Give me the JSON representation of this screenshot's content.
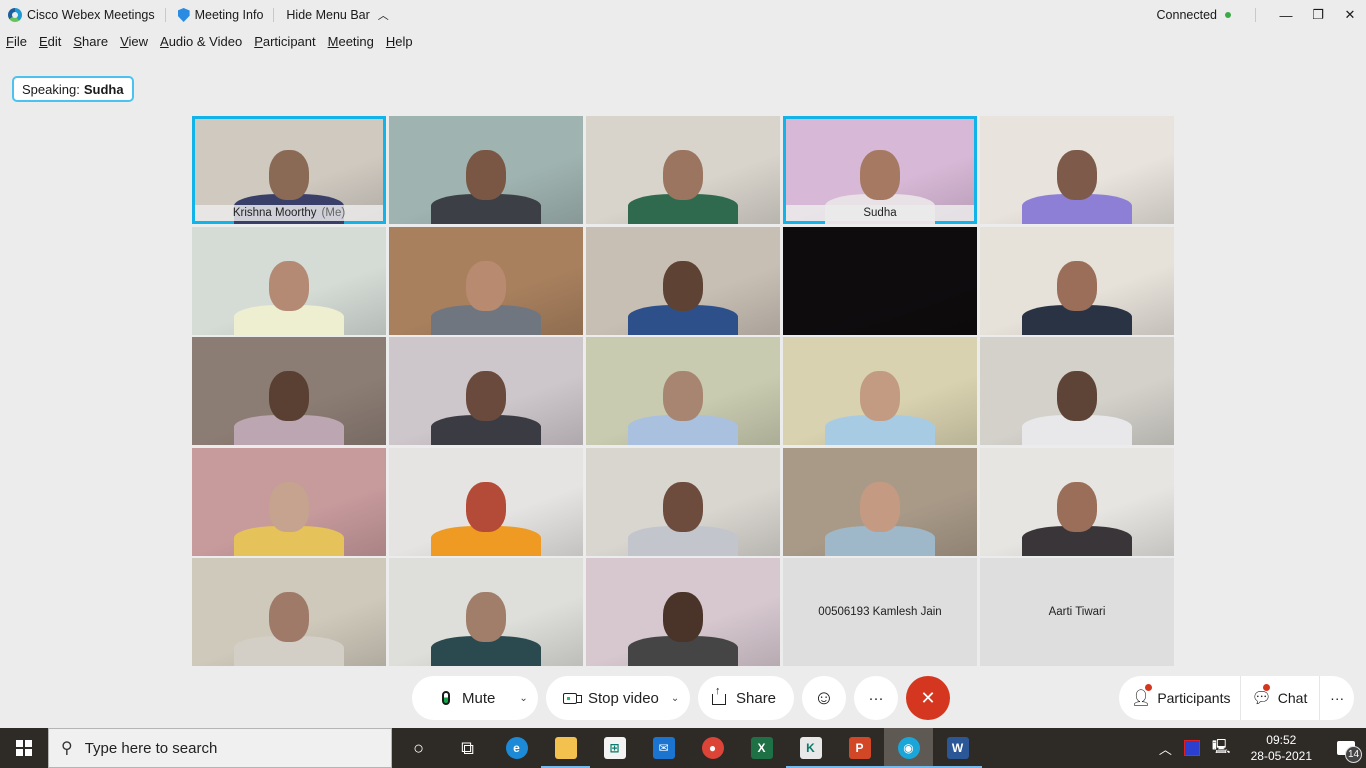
{
  "titlebar": {
    "app_name": "Cisco Webex Meetings",
    "meeting_info": "Meeting Info",
    "hide_menu_bar": "Hide Menu Bar",
    "status": "Connected",
    "status_color": "#3bab48",
    "minimize": "—",
    "restore": "❐",
    "close": "✕"
  },
  "menu": {
    "items": [
      {
        "mnemonic": "F",
        "rest": "ile"
      },
      {
        "mnemonic": "E",
        "rest": "dit"
      },
      {
        "mnemonic": "S",
        "rest": "hare"
      },
      {
        "mnemonic": "V",
        "rest": "iew"
      },
      {
        "mnemonic": "A",
        "rest": "udio & Video"
      },
      {
        "mnemonic": "P",
        "rest": "articipant"
      },
      {
        "mnemonic": "M",
        "rest": "eeting"
      },
      {
        "mnemonic": "H",
        "rest": "elp"
      }
    ]
  },
  "speaking": {
    "prefix": "Speaking:",
    "name": "Sudha"
  },
  "participants": [
    {
      "name": "Krishna Moorthy",
      "suffix": "(Me)",
      "active": true,
      "video": true,
      "bg": "#cfc9c0",
      "skin": "#8a6a55",
      "shirt": "#3a3f6a"
    },
    {
      "name": "",
      "video": true,
      "bg": "#9fb3b0",
      "skin": "#7a5744",
      "shirt": "#3c3f46"
    },
    {
      "name": "",
      "video": true,
      "bg": "#d8d4cc",
      "skin": "#9b7560",
      "shirt": "#2f6a4f"
    },
    {
      "name": "Sudha",
      "active": true,
      "video": true,
      "bg": "#d7b8d6",
      "skin": "#a67a62",
      "shirt": "#e8e2e6"
    },
    {
      "name": "",
      "video": true,
      "bg": "#e8e3dc",
      "skin": "#7d5a4a",
      "shirt": "#8e7fd6"
    },
    {
      "name": "",
      "video": true,
      "bg": "#d5dcd6",
      "skin": "#b48a75",
      "shirt": "#eeeed0"
    },
    {
      "name": "",
      "video": true,
      "bg": "#a8805e",
      "skin": "#b88a70",
      "shirt": "#707680"
    },
    {
      "name": "",
      "video": true,
      "bg": "#c8bfb4",
      "skin": "#5e4334",
      "shirt": "#2d4f8a"
    },
    {
      "name": "",
      "video": true,
      "bg": "#0f0c0e",
      "skin": "#0f0c0e",
      "shirt": "#0f0c0e",
      "blank": true
    },
    {
      "name": "",
      "video": true,
      "bg": "#e6e1d9",
      "skin": "#9a6e58",
      "shirt": "#2a3344"
    },
    {
      "name": "",
      "video": true,
      "bg": "#8c7d74",
      "skin": "#5a3f33",
      "shirt": "#bba6b2"
    },
    {
      "name": "",
      "video": true,
      "bg": "#cdc6cb",
      "skin": "#6a4a3d",
      "shirt": "#3b3b43"
    },
    {
      "name": "",
      "video": true,
      "bg": "#c9cbb0",
      "skin": "#a88571",
      "shirt": "#a9c1de"
    },
    {
      "name": "",
      "video": true,
      "bg": "#d9d2b0",
      "skin": "#c39b83",
      "shirt": "#a8cbe4"
    },
    {
      "name": "",
      "video": true,
      "bg": "#d3d1ca",
      "skin": "#5e4436",
      "shirt": "#e8e8ea"
    },
    {
      "name": "",
      "video": true,
      "bg": "#c79a9c",
      "skin": "#c5a38f",
      "shirt": "#e5c25a"
    },
    {
      "name": "",
      "video": true,
      "bg": "#e5e4e2",
      "skin": "#b44a38",
      "shirt": "#ee9a23"
    },
    {
      "name": "",
      "video": true,
      "bg": "#d9d6d0",
      "skin": "#6d4c3e",
      "shirt": "#c2c6cc"
    },
    {
      "name": "",
      "video": true,
      "bg": "#a99a88",
      "skin": "#c59a82",
      "shirt": "#9fb8c9"
    },
    {
      "name": "",
      "video": true,
      "bg": "#e7e5e2",
      "skin": "#9a6e58",
      "shirt": "#3a3538"
    },
    {
      "name": "",
      "video": true,
      "bg": "#cfc9bb",
      "skin": "#a07a68",
      "shirt": "#d4cfc6"
    },
    {
      "name": "",
      "video": true,
      "bg": "#dedfda",
      "skin": "#a07e6a",
      "shirt": "#2a4a50"
    },
    {
      "name": "",
      "video": true,
      "bg": "#d7c8d0",
      "skin": "#4a3328",
      "shirt": "#454545"
    },
    {
      "name": "00506193 Kamlesh Jain",
      "video": false
    },
    {
      "name": "Aarti Tiwari",
      "video": false
    }
  ],
  "controls": {
    "mute": "Mute",
    "stop_video": "Stop video",
    "share": "Share",
    "reactions_icon": "☺",
    "more": "···",
    "end_icon": "✕",
    "end_color": "#d4361f",
    "participants": "Participants",
    "chat": "Chat",
    "panel_more": "···"
  },
  "taskbar": {
    "search_placeholder": "Type here to search",
    "apps": [
      {
        "name": "cortana",
        "glyph": "○",
        "color": "transparent"
      },
      {
        "name": "task-view",
        "glyph": "⧉",
        "color": "transparent"
      },
      {
        "name": "edge",
        "glyph": "e",
        "color": "#1c8ad6"
      },
      {
        "name": "file-explorer",
        "glyph": "",
        "color": "#f2c14e",
        "running": true
      },
      {
        "name": "microsoft-store",
        "glyph": "⊞",
        "color": "#f3f3f3"
      },
      {
        "name": "mail",
        "glyph": "✉",
        "color": "#1b75d0"
      },
      {
        "name": "chrome",
        "glyph": "●",
        "color": "#db4437"
      },
      {
        "name": "excel",
        "glyph": "X",
        "color": "#1e7145"
      },
      {
        "name": "file-k",
        "glyph": "K",
        "color": "#e8e8e8",
        "running": true
      },
      {
        "name": "powerpoint",
        "glyph": "P",
        "color": "#d24726",
        "running": true
      },
      {
        "name": "webex",
        "glyph": "◉",
        "color": "#1ba6d9",
        "running": true,
        "active": true
      },
      {
        "name": "word",
        "glyph": "W",
        "color": "#2b5797",
        "running": true
      }
    ],
    "time": "09:52",
    "date": "28-05-2021",
    "notification_count": "14"
  }
}
